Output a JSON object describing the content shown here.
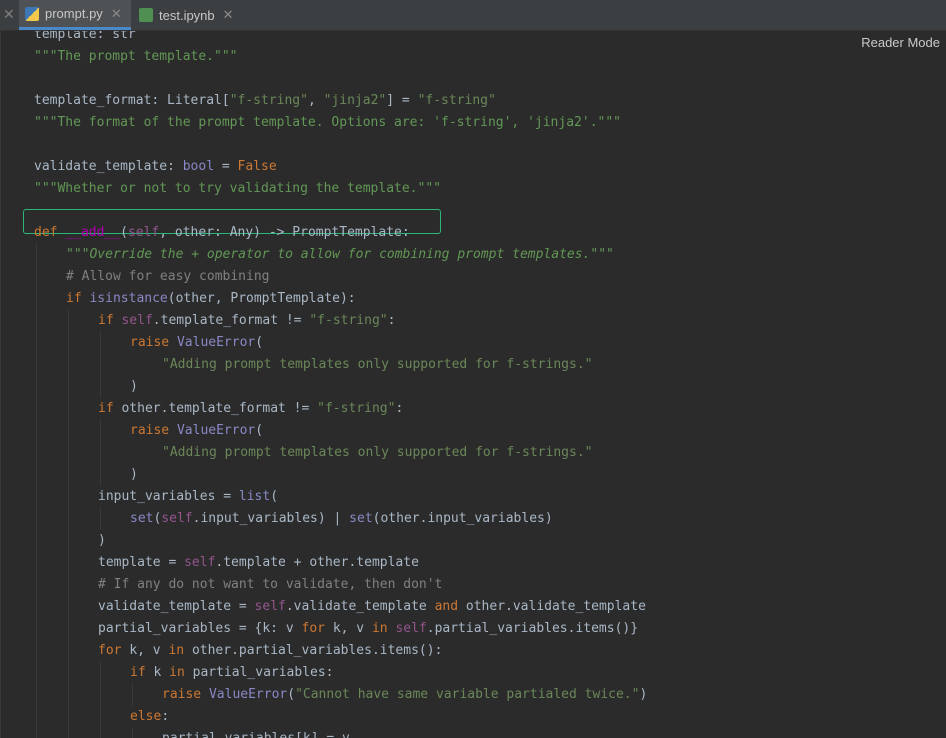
{
  "tabs": [
    {
      "label": "prompt.py",
      "close": "✕"
    },
    {
      "label": "test.ipynb",
      "close": "✕"
    }
  ],
  "left_close": "✕",
  "reader_mode_label": "Reader Mode",
  "code": {
    "lines": [
      {
        "indent": 0,
        "tokens": [
          [
            "template: str",
            "t-default"
          ]
        ]
      },
      {
        "indent": 0,
        "tokens": [
          [
            "\"\"\"The prompt template.\"\"\"",
            "t-doc-plain"
          ]
        ]
      },
      {
        "indent": 0,
        "tokens": []
      },
      {
        "indent": 0,
        "tokens": [
          [
            "template_format",
            "t-default"
          ],
          [
            ": Literal[",
            "t-default"
          ],
          [
            "\"f-string\"",
            "t-string"
          ],
          [
            ", ",
            "t-default"
          ],
          [
            "\"jinja2\"",
            "t-string"
          ],
          [
            "] = ",
            "t-default"
          ],
          [
            "\"f-string\"",
            "t-string"
          ]
        ]
      },
      {
        "indent": 0,
        "tokens": [
          [
            "\"\"\"The format of the prompt template. Options are: 'f-string', 'jinja2'.\"\"\"",
            "t-doc-plain"
          ]
        ]
      },
      {
        "indent": 0,
        "tokens": []
      },
      {
        "indent": 0,
        "tokens": [
          [
            "validate_template",
            "t-default"
          ],
          [
            ": ",
            "t-default"
          ],
          [
            "bool",
            "t-builtin"
          ],
          [
            " = ",
            "t-default"
          ],
          [
            "False",
            "t-keyword"
          ]
        ]
      },
      {
        "indent": 0,
        "tokens": [
          [
            "\"\"\"Whether or not to try validating the template.\"\"\"",
            "t-doc-plain"
          ]
        ]
      },
      {
        "indent": 0,
        "tokens": []
      },
      {
        "indent": 0,
        "tokens": [
          [
            "def ",
            "t-keyword"
          ],
          [
            "__add__",
            "t-magic"
          ],
          [
            "(",
            "t-default"
          ],
          [
            "self",
            "t-self"
          ],
          [
            ", other: Any) -> PromptTemplate:",
            "t-default"
          ]
        ]
      },
      {
        "indent": 1,
        "tokens": [
          [
            "\"\"\"Override the + operator to allow for combining prompt templates.\"\"\"",
            "t-doc"
          ]
        ]
      },
      {
        "indent": 1,
        "tokens": [
          [
            "# Allow for easy combining",
            "t-comment"
          ]
        ]
      },
      {
        "indent": 1,
        "tokens": [
          [
            "if ",
            "t-keyword"
          ],
          [
            "isinstance",
            "t-builtin"
          ],
          [
            "(other, PromptTemplate):",
            "t-default"
          ]
        ]
      },
      {
        "indent": 2,
        "tokens": [
          [
            "if ",
            "t-keyword"
          ],
          [
            "self",
            "t-self"
          ],
          [
            ".template_format != ",
            "t-default"
          ],
          [
            "\"f-string\"",
            "t-string"
          ],
          [
            ":",
            "t-default"
          ]
        ]
      },
      {
        "indent": 3,
        "tokens": [
          [
            "raise ",
            "t-keyword"
          ],
          [
            "ValueError",
            "t-builtin"
          ],
          [
            "(",
            "t-default"
          ]
        ]
      },
      {
        "indent": 4,
        "tokens": [
          [
            "\"Adding prompt templates only supported for f-strings.\"",
            "t-string"
          ]
        ]
      },
      {
        "indent": 3,
        "tokens": [
          [
            ")",
            "t-default"
          ]
        ]
      },
      {
        "indent": 2,
        "tokens": [
          [
            "if ",
            "t-keyword"
          ],
          [
            "other.template_format != ",
            "t-default"
          ],
          [
            "\"f-string\"",
            "t-string"
          ],
          [
            ":",
            "t-default"
          ]
        ]
      },
      {
        "indent": 3,
        "tokens": [
          [
            "raise ",
            "t-keyword"
          ],
          [
            "ValueError",
            "t-builtin"
          ],
          [
            "(",
            "t-default"
          ]
        ]
      },
      {
        "indent": 4,
        "tokens": [
          [
            "\"Adding prompt templates only supported for f-strings.\"",
            "t-string"
          ]
        ]
      },
      {
        "indent": 3,
        "tokens": [
          [
            ")",
            "t-default"
          ]
        ]
      },
      {
        "indent": 2,
        "tokens": [
          [
            "input_variables = ",
            "t-default"
          ],
          [
            "list",
            "t-builtin"
          ],
          [
            "(",
            "t-default"
          ]
        ]
      },
      {
        "indent": 3,
        "tokens": [
          [
            "set",
            "t-builtin"
          ],
          [
            "(",
            "t-default"
          ],
          [
            "self",
            "t-self"
          ],
          [
            ".input_variables) | ",
            "t-default"
          ],
          [
            "set",
            "t-builtin"
          ],
          [
            "(other.input_variables)",
            "t-default"
          ]
        ]
      },
      {
        "indent": 2,
        "tokens": [
          [
            ")",
            "t-default"
          ]
        ]
      },
      {
        "indent": 2,
        "tokens": [
          [
            "template = ",
            "t-default"
          ],
          [
            "self",
            "t-self"
          ],
          [
            ".template + other.template",
            "t-default"
          ]
        ]
      },
      {
        "indent": 2,
        "tokens": [
          [
            "# If any do not want to validate, then don't",
            "t-comment"
          ]
        ]
      },
      {
        "indent": 2,
        "tokens": [
          [
            "validate_template = ",
            "t-default"
          ],
          [
            "self",
            "t-self"
          ],
          [
            ".validate_template ",
            "t-default"
          ],
          [
            "and ",
            "t-keyword"
          ],
          [
            "other.validate_template",
            "t-default"
          ]
        ]
      },
      {
        "indent": 2,
        "tokens": [
          [
            "partial_variables = {k: v ",
            "t-default"
          ],
          [
            "for ",
            "t-keyword"
          ],
          [
            "k, v ",
            "t-default"
          ],
          [
            "in ",
            "t-keyword"
          ],
          [
            "self",
            "t-self"
          ],
          [
            ".partial_variables.items()}",
            "t-default"
          ]
        ]
      },
      {
        "indent": 2,
        "tokens": [
          [
            "for ",
            "t-keyword"
          ],
          [
            "k, v ",
            "t-default"
          ],
          [
            "in ",
            "t-keyword"
          ],
          [
            "other.partial_variables.items():",
            "t-default"
          ]
        ]
      },
      {
        "indent": 3,
        "tokens": [
          [
            "if ",
            "t-keyword"
          ],
          [
            "k ",
            "t-default"
          ],
          [
            "in ",
            "t-keyword"
          ],
          [
            "partial_variables:",
            "t-default"
          ]
        ]
      },
      {
        "indent": 4,
        "tokens": [
          [
            "raise ",
            "t-keyword"
          ],
          [
            "ValueError",
            "t-builtin"
          ],
          [
            "(",
            "t-default"
          ],
          [
            "\"Cannot have same variable partialed twice.\"",
            "t-string"
          ],
          [
            ")",
            "t-default"
          ]
        ]
      },
      {
        "indent": 3,
        "tokens": [
          [
            "else",
            "t-keyword"
          ],
          [
            ":",
            "t-default"
          ]
        ]
      },
      {
        "indent": 4,
        "tokens": [
          [
            "partial_variables[k] = v",
            "t-default"
          ]
        ]
      }
    ]
  }
}
